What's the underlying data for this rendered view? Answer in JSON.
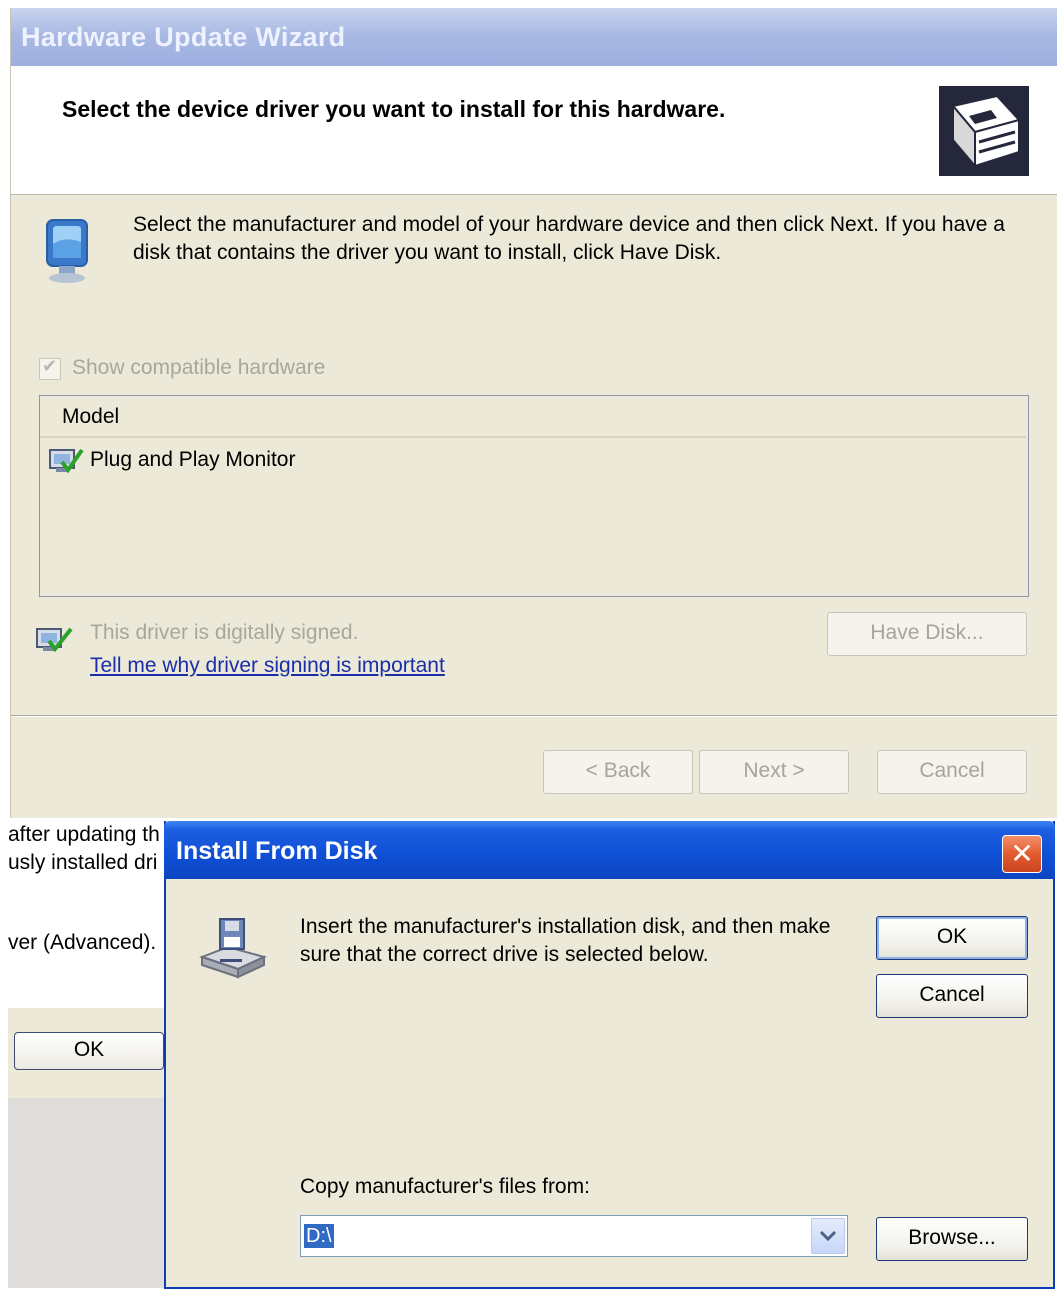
{
  "wizard": {
    "title": "Hardware Update Wizard",
    "heading": "Select the device driver you want to install for this hardware.",
    "description": "Select the manufacturer and model of your hardware device and then click Next. If you have a disk that contains the driver you want to install, click Have Disk.",
    "show_compatible_label": "Show compatible hardware",
    "show_compatible_checked": true,
    "model_list": {
      "column_header": "Model",
      "items": [
        "Plug and Play Monitor"
      ]
    },
    "signed_text": "This driver is digitally signed.",
    "signing_link": "Tell me why driver signing is important",
    "have_disk_label": "Have Disk...",
    "back_label": "< Back",
    "next_label": "Next >",
    "cancel_label": "Cancel"
  },
  "background_dialog": {
    "line1": "after updating th",
    "line2": "usly installed dri",
    "line3": "ver (Advanced).",
    "ok_label": "OK"
  },
  "install_from_disk": {
    "title": "Install From Disk",
    "message": "Insert the manufacturer's installation disk, and then make sure that the correct drive is selected below.",
    "ok_label": "OK",
    "cancel_label": "Cancel",
    "copy_label": "Copy manufacturer's files from:",
    "path_value": "D:\\",
    "browse_label": "Browse..."
  },
  "colors": {
    "xp_title_blue": "#0f4fd5",
    "dialog_face": "#ece9d8",
    "disabled_text": "#a9a799",
    "link_blue": "#1a2ea8",
    "selection_blue": "#316ac5"
  },
  "icons": {
    "header": "hardware-card-icon",
    "info": "monitor-icon",
    "model_item": "monitor-driver-icon",
    "signed": "signed-driver-icon",
    "disk": "floppy-drive-icon",
    "close": "close-icon",
    "dropdown": "chevron-down-icon"
  }
}
